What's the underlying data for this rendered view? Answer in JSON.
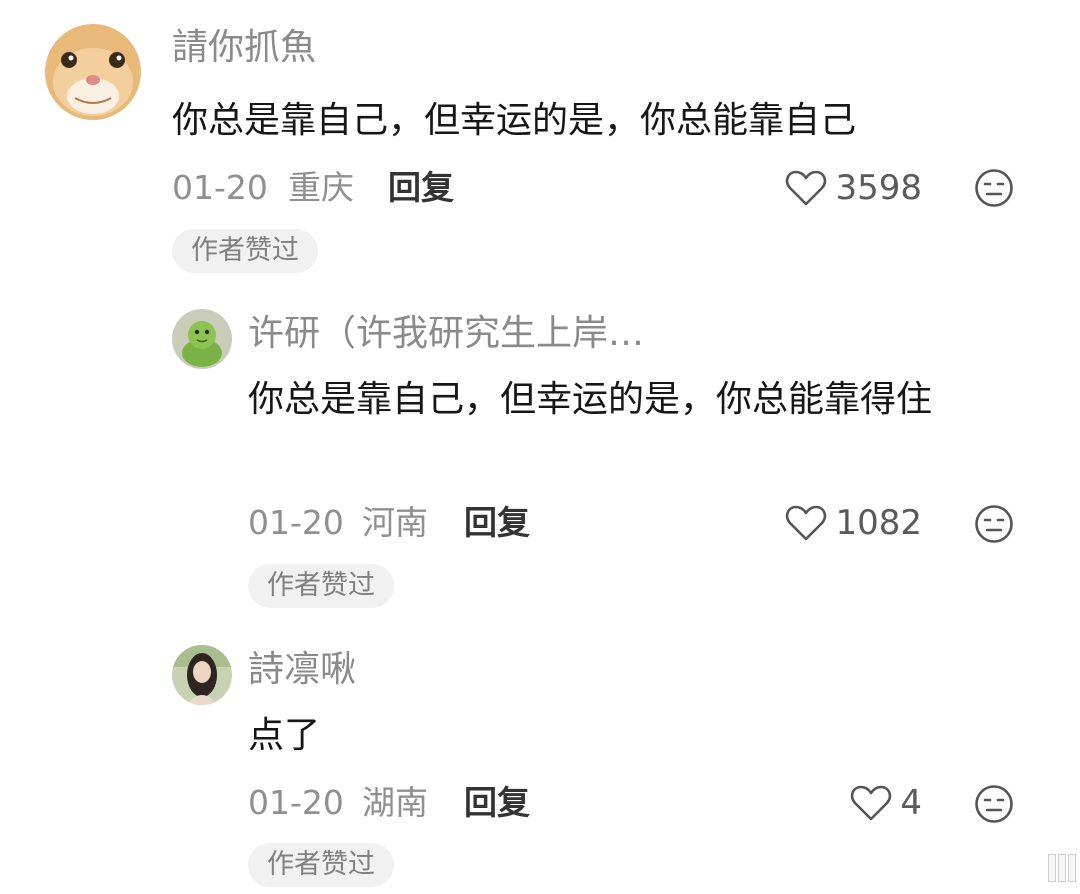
{
  "comments": [
    {
      "username": "請你抓魚",
      "text": "你总是靠自己，但幸运的是，你总能靠自己",
      "date": "01-20",
      "location": "重庆",
      "reply_label": "回复",
      "likes": "3598",
      "badge": "作者赞过"
    },
    {
      "username": "许研（许我研究生上岸…",
      "text": "你总是靠自己，但幸运的是，你总能靠得住",
      "date": "01-20",
      "location": "河南",
      "reply_label": "回复",
      "likes": "1082",
      "badge": "作者赞过"
    },
    {
      "username": "詩凛啾",
      "text": "点了",
      "date": "01-20",
      "location": "湖南",
      "reply_label": "回复",
      "likes": "4",
      "badge": "作者赞过"
    }
  ],
  "icons": {
    "like": "heart-outline-icon",
    "dislike": "meh-face-icon"
  },
  "colors": {
    "username": "#8a8a8a",
    "text": "#161616",
    "meta": "#8f8f8f",
    "badge_bg": "#f1f1f1"
  }
}
